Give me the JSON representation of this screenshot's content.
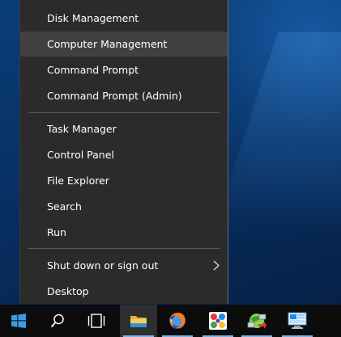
{
  "menu": {
    "items": [
      {
        "label": "Disk Management"
      },
      {
        "label": "Computer Management"
      },
      {
        "label": "Command Prompt"
      },
      {
        "label": "Command Prompt (Admin)"
      },
      {
        "label": "Task Manager"
      },
      {
        "label": "Control Panel"
      },
      {
        "label": "File Explorer"
      },
      {
        "label": "Search"
      },
      {
        "label": "Run"
      },
      {
        "label": "Shut down or sign out"
      },
      {
        "label": "Desktop"
      }
    ],
    "highlighted_item": "Computer Management"
  },
  "taskbar": {
    "buttons": [
      {
        "icon": "windows-start-icon"
      },
      {
        "icon": "search-icon"
      },
      {
        "icon": "task-view-icon"
      },
      {
        "icon": "file-explorer-icon"
      },
      {
        "icon": "firefox-icon"
      },
      {
        "icon": "app-colorful-icon"
      },
      {
        "icon": "network-globe-icon"
      },
      {
        "icon": "computer-screen-icon"
      }
    ]
  },
  "colors": {
    "menu_bg": "#2b2b2b",
    "menu_hover": "#414141",
    "taskbar_bg": "#0c0c0c",
    "accent": "#7fb4e8",
    "desktop_blue": "#0a3e79"
  }
}
